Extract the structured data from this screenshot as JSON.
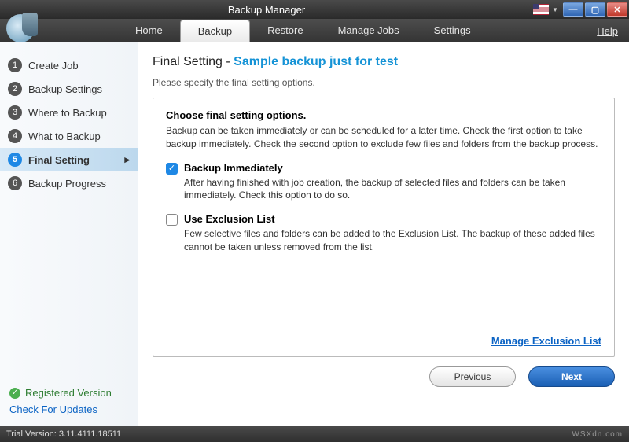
{
  "window": {
    "title": "Backup Manager"
  },
  "menubar": {
    "tabs": [
      "Home",
      "Backup",
      "Restore",
      "Manage Jobs",
      "Settings"
    ],
    "active_index": 1,
    "help": "Help"
  },
  "sidebar": {
    "steps": [
      {
        "n": "1",
        "label": "Create Job"
      },
      {
        "n": "2",
        "label": "Backup Settings"
      },
      {
        "n": "3",
        "label": "Where to Backup"
      },
      {
        "n": "4",
        "label": "What to Backup"
      },
      {
        "n": "5",
        "label": "Final Setting"
      },
      {
        "n": "6",
        "label": "Backup Progress"
      }
    ],
    "active_index": 4,
    "registered": "Registered Version",
    "updates": "Check For Updates"
  },
  "content": {
    "heading_prefix": "Final Setting - ",
    "heading_job": "Sample backup just for test",
    "subheading": "Please specify the final setting options.",
    "panel_title": "Choose final setting options.",
    "panel_desc": "Backup can be taken immediately or can be scheduled for a later time. Check the first option to take backup immediately. Check the second option to exclude few files and folders from the backup process.",
    "options": [
      {
        "label": "Backup Immediately",
        "checked": true,
        "desc": "After having finished with job creation, the backup of selected files and folders can be taken immediately. Check this option to do so."
      },
      {
        "label": "Use Exclusion List",
        "checked": false,
        "desc": "Few selective files and folders can be added to the Exclusion List. The backup of these added files cannot be taken unless removed from the list."
      }
    ],
    "manage_link": "Manage Exclusion List",
    "prev": "Previous",
    "next": "Next"
  },
  "statusbar": {
    "trial": "Trial Version: 3.11.4111.18511",
    "watermark": "WSXdn.com"
  }
}
